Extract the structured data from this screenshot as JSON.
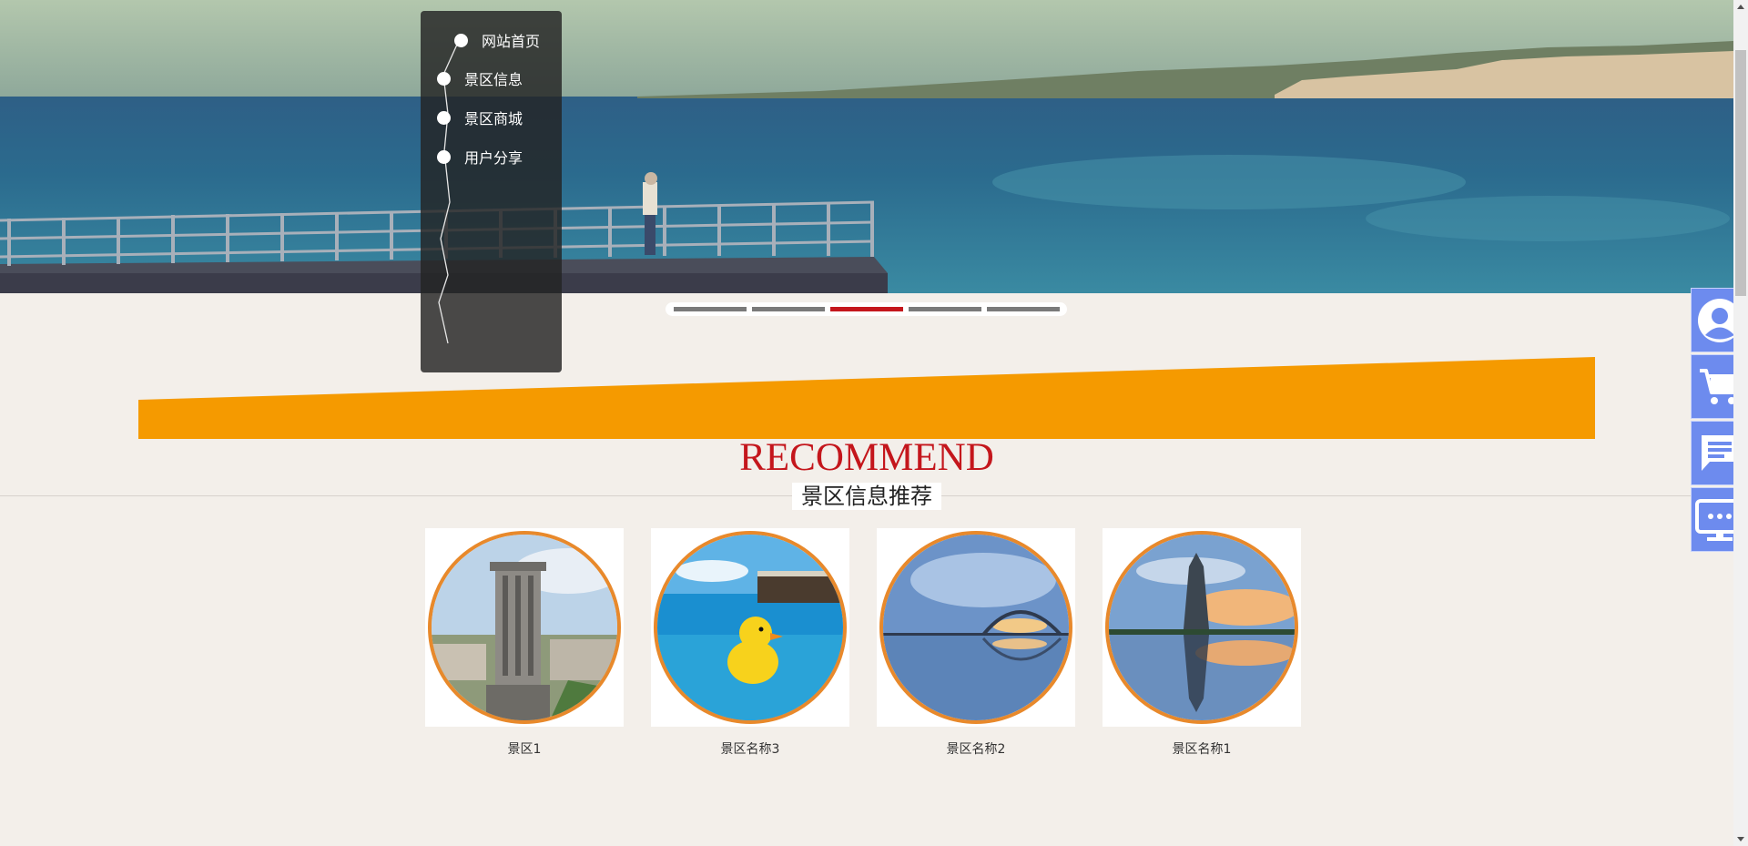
{
  "nav": {
    "items": [
      {
        "label": "网站首页"
      },
      {
        "label": "景区信息"
      },
      {
        "label": "景区商城"
      },
      {
        "label": "用户分享"
      }
    ]
  },
  "slider": {
    "count": 5,
    "active_index": 2
  },
  "section": {
    "title_en": "RECOMMEND",
    "title_cn": "景区信息推荐"
  },
  "cards": [
    {
      "name": "景区1"
    },
    {
      "name": "景区名称3"
    },
    {
      "name": "景区名称2"
    },
    {
      "name": "景区名称1"
    }
  ],
  "sidebar": {
    "buttons": [
      {
        "icon": "user-icon"
      },
      {
        "icon": "cart-icon"
      },
      {
        "icon": "message-icon"
      },
      {
        "icon": "monitor-icon"
      }
    ]
  },
  "colors": {
    "accent_red": "#c4161c",
    "orange": "#f59a00",
    "card_border": "#e8892b",
    "sidebar_blue": "#6d8bee",
    "background": "#f3efea"
  }
}
